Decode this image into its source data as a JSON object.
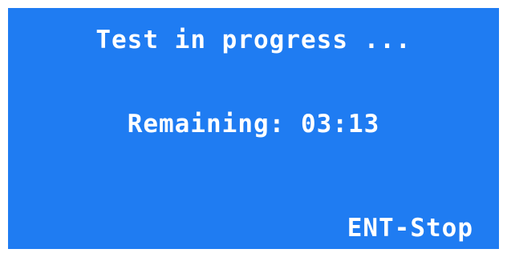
{
  "screen": {
    "background_color": "#1f7cf2",
    "text_color": "#ffffff",
    "status_text": "Test in progress ...",
    "remaining_text": "Remaining: 03:13",
    "softkey_label": "ENT-Stop"
  }
}
